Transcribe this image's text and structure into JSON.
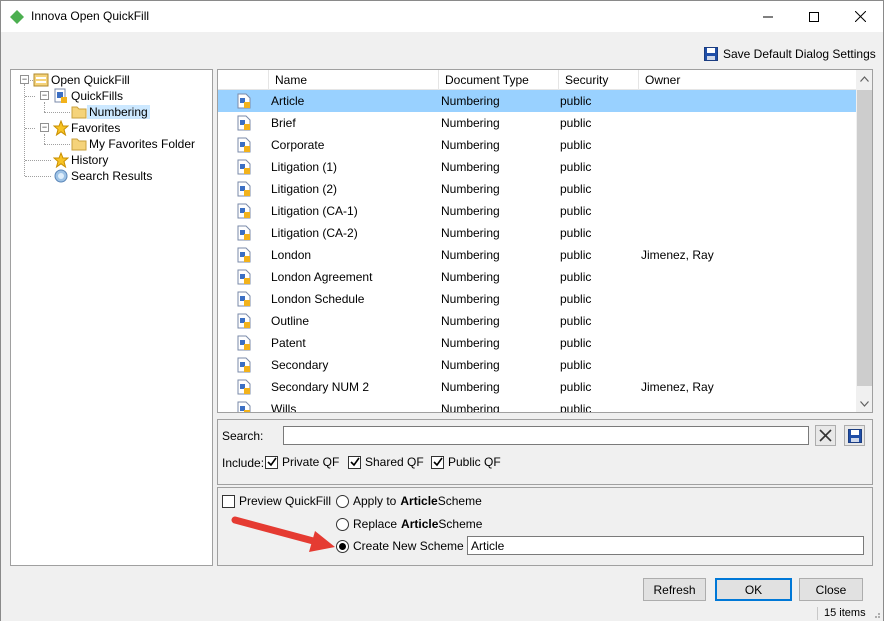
{
  "window": {
    "title": "Innova Open QuickFill",
    "accent": "#4caf50"
  },
  "toolbar": {
    "save_default_label": "Save Default Dialog Settings"
  },
  "tree": {
    "root": "Open QuickFill",
    "quickfills": "QuickFills",
    "numbering": "Numbering",
    "favorites": "Favorites",
    "my_favorites": "My Favorites Folder",
    "history": "History",
    "search_results": "Search Results"
  },
  "list": {
    "columns": [
      "Name",
      "Document Type",
      "Security",
      "Owner"
    ],
    "rows": [
      {
        "name": "Article",
        "type": "Numbering",
        "security": "public",
        "owner": ""
      },
      {
        "name": "Brief",
        "type": "Numbering",
        "security": "public",
        "owner": ""
      },
      {
        "name": "Corporate",
        "type": "Numbering",
        "security": "public",
        "owner": ""
      },
      {
        "name": "Litigation (1)",
        "type": "Numbering",
        "security": "public",
        "owner": ""
      },
      {
        "name": "Litigation (2)",
        "type": "Numbering",
        "security": "public",
        "owner": ""
      },
      {
        "name": "Litigation (CA-1)",
        "type": "Numbering",
        "security": "public",
        "owner": ""
      },
      {
        "name": "Litigation (CA-2)",
        "type": "Numbering",
        "security": "public",
        "owner": ""
      },
      {
        "name": "London",
        "type": "Numbering",
        "security": "public",
        "owner": "Jimenez, Ray"
      },
      {
        "name": "London Agreement",
        "type": "Numbering",
        "security": "public",
        "owner": ""
      },
      {
        "name": "London Schedule",
        "type": "Numbering",
        "security": "public",
        "owner": ""
      },
      {
        "name": "Outline",
        "type": "Numbering",
        "security": "public",
        "owner": ""
      },
      {
        "name": "Patent",
        "type": "Numbering",
        "security": "public",
        "owner": ""
      },
      {
        "name": "Secondary",
        "type": "Numbering",
        "security": "public",
        "owner": ""
      },
      {
        "name": "Secondary NUM 2",
        "type": "Numbering",
        "security": "public",
        "owner": "Jimenez, Ray"
      },
      {
        "name": "Wills",
        "type": "Numbering",
        "security": "public",
        "owner": ""
      }
    ]
  },
  "search": {
    "label": "Search:",
    "value": "",
    "include_label": "Include:",
    "private_qf": "Private QF",
    "shared_qf": "Shared QF",
    "public_qf": "Public QF"
  },
  "options": {
    "preview_label": "Preview QuickFill",
    "apply_prefix": "Apply to",
    "apply_bold": "Article",
    "apply_suffix": "Scheme",
    "replace_prefix": "Replace",
    "replace_bold": "Article",
    "replace_suffix": "Scheme",
    "create_label": "Create New Scheme",
    "scheme_name": "Article"
  },
  "buttons": {
    "refresh": "Refresh",
    "ok": "OK",
    "close": "Close"
  },
  "status": {
    "count": "15 items"
  }
}
